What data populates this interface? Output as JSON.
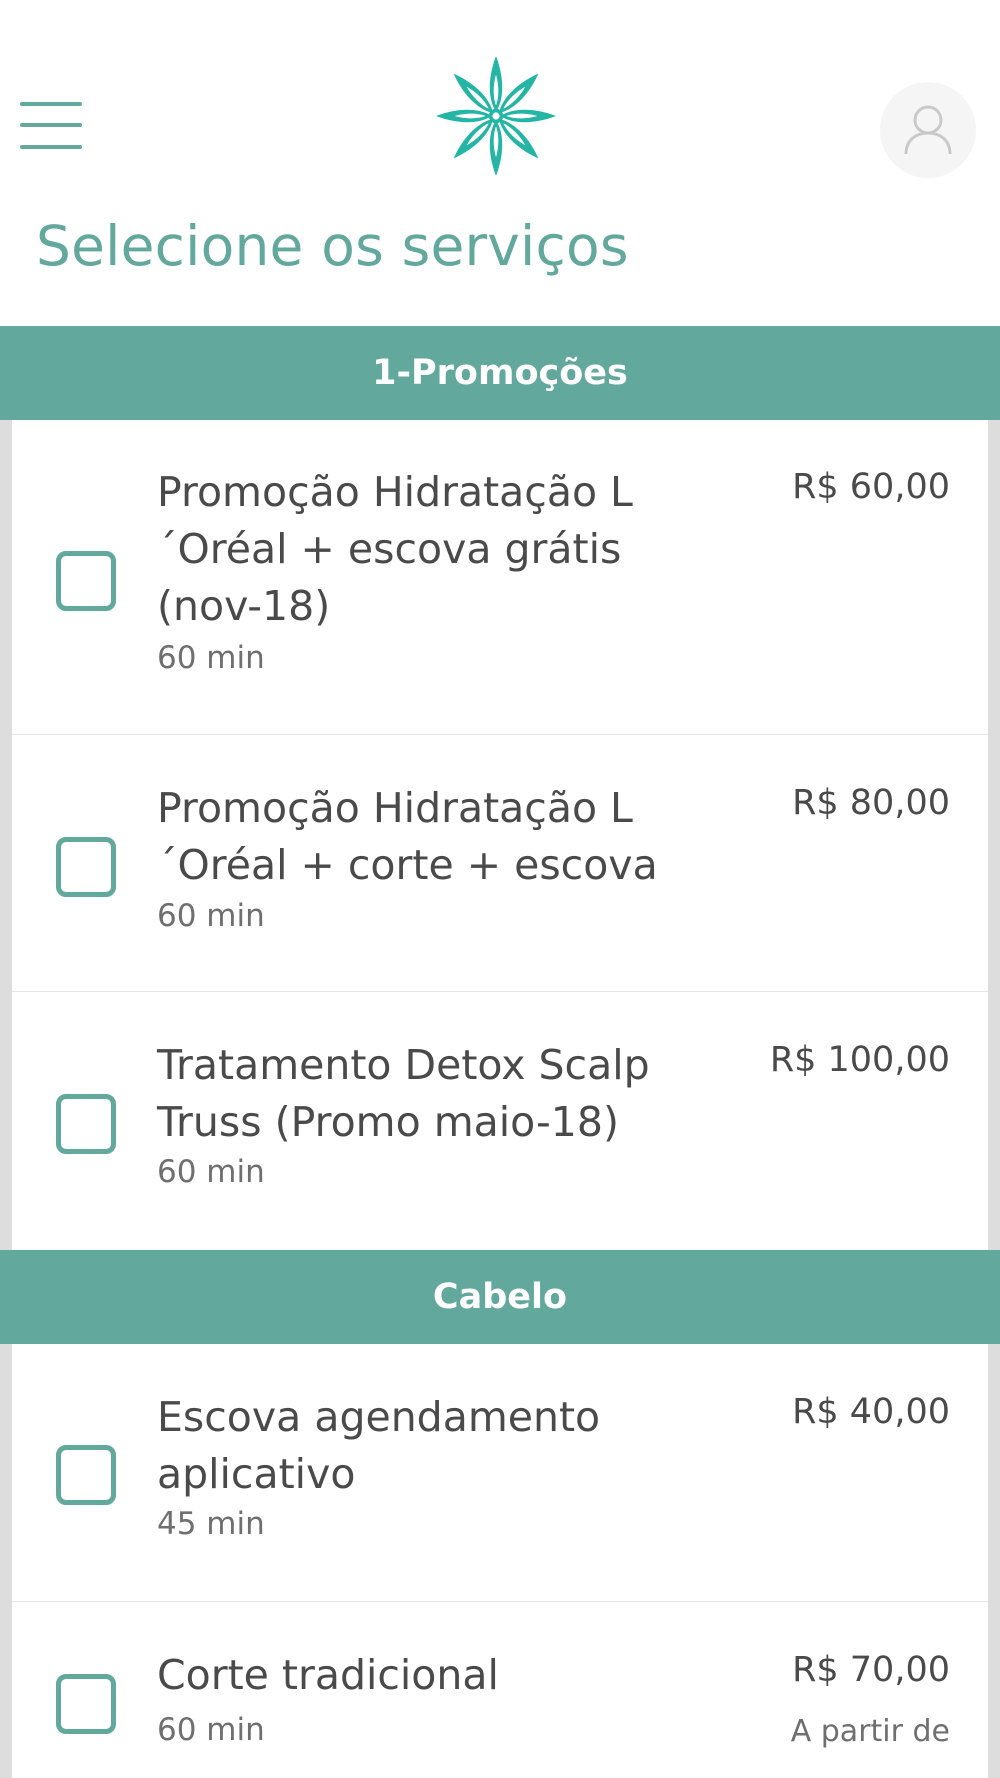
{
  "header": {
    "menu_icon": "hamburger-menu-icon",
    "logo_icon": "flower-logo-icon",
    "profile_icon": "user-profile-icon"
  },
  "page_title": "Selecione os serviços",
  "colors": {
    "accent": "#63a89c",
    "text": "#4a4a4a",
    "muted": "#6f6f6f"
  },
  "sections": [
    {
      "title": "1-Promoções",
      "items": [
        {
          "name": "Promoção Hidratação L ´Oréal + escova grátis (nov-18)",
          "duration": "60 min",
          "price": "R$ 60,00",
          "note": ""
        },
        {
          "name": "Promoção Hidratação L ´Oréal + corte + escova",
          "duration": "60 min",
          "price": "R$ 80,00",
          "note": ""
        },
        {
          "name": "Tratamento Detox Scalp Truss (Promo maio-18)",
          "duration": "60 min",
          "price": "R$ 100,00",
          "note": ""
        }
      ]
    },
    {
      "title": "Cabelo",
      "items": [
        {
          "name": "Escova agendamento aplicativo",
          "duration": "45 min",
          "price": "R$ 40,00",
          "note": ""
        },
        {
          "name": "Corte tradicional",
          "duration": "60 min",
          "price": "R$ 70,00",
          "note": "A partir de"
        }
      ]
    }
  ]
}
